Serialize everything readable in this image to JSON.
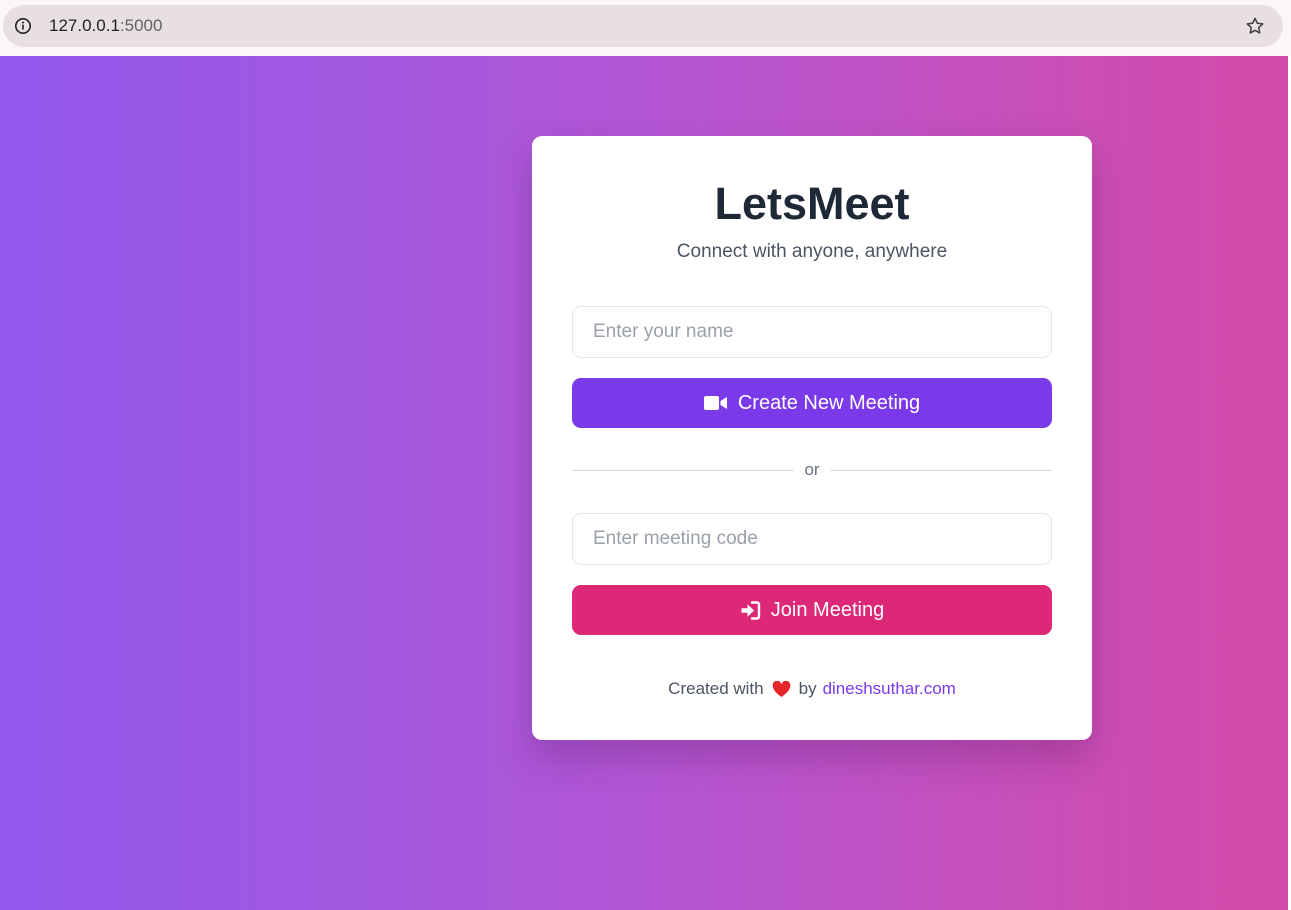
{
  "browser": {
    "url_host": "127.0.0.1",
    "url_port": ":5000"
  },
  "app": {
    "title": "LetsMeet",
    "subtitle": "Connect with anyone, anywhere"
  },
  "form": {
    "name_placeholder": "Enter your name",
    "create_label": "Create New Meeting",
    "divider_text": "or",
    "code_placeholder": "Enter meeting code",
    "join_label": "Join Meeting"
  },
  "footer": {
    "prefix": "Created with",
    "by": "by",
    "link_text": "dineshsuthar.com"
  },
  "icons": {
    "info": "info-icon",
    "star": "star-icon",
    "video": "video-camera-icon",
    "signin": "sign-in-icon",
    "heart": "heart-icon"
  },
  "colors": {
    "primary": "#7b3aea",
    "join": "#dc2877",
    "gradient_start": "#9359ee",
    "gradient_end": "#d44aa8"
  }
}
